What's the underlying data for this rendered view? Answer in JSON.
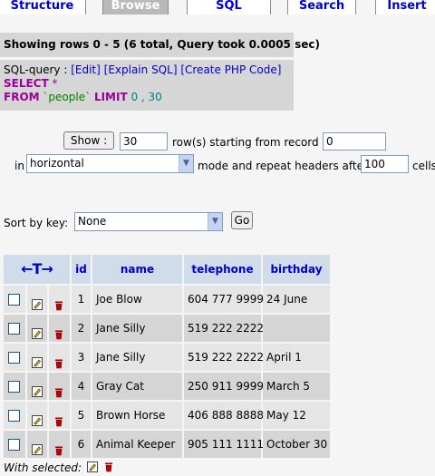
{
  "tabs": [
    {
      "label": "Structure",
      "active": false
    },
    {
      "label": "Browse",
      "active": true
    },
    {
      "label": "SQL",
      "active": false
    },
    {
      "label": "Search",
      "active": false
    },
    {
      "label": "Insert",
      "active": false
    }
  ],
  "status_message": "Showing rows 0 - 5 (6 total, Query took 0.0005 sec)",
  "sql": {
    "label": "SQL-query :",
    "edit": "[Edit]",
    "explain": "[Explain SQL]",
    "create_php": "[Create PHP Code]",
    "select_kw": "SELECT",
    "star": "*",
    "from_kw": "FROM",
    "table": "`people`",
    "limit_kw": "LIMIT",
    "limit_args": "0 , 30"
  },
  "nav": {
    "show_button": "Show :",
    "rows_value": "30",
    "rows_text": "row(s) starting from record #",
    "start_value": "0",
    "in_text": "in",
    "mode_value": "horizontal",
    "mode_text": "mode and repeat headers after",
    "repeat_value": "100",
    "cells_text": "cells"
  },
  "sort": {
    "label": "Sort by key:",
    "value": "None",
    "go_button": "Go"
  },
  "table": {
    "arrows": "←T→",
    "headers": [
      "id",
      "name",
      "telephone",
      "birthday"
    ],
    "rows": [
      {
        "id": "1",
        "name": "Joe Blow",
        "telephone": "604 777 9999",
        "birthday": "24 June"
      },
      {
        "id": "2",
        "name": "Jane Silly",
        "telephone": "519 222 2222",
        "birthday": ""
      },
      {
        "id": "3",
        "name": "Jane Silly",
        "telephone": "519 222 2222",
        "birthday": "April 1"
      },
      {
        "id": "4",
        "name": "Gray Cat",
        "telephone": "250 911 9999",
        "birthday": "March 5"
      },
      {
        "id": "5",
        "name": "Brown Horse",
        "telephone": "406 888 8888",
        "birthday": "May 12"
      },
      {
        "id": "6",
        "name": "Animal Keeper",
        "telephone": "905 111 1111",
        "birthday": "October 30"
      }
    ]
  },
  "with_selected": "With selected:",
  "colors": {
    "tab_text": "#0000cc",
    "header_bg": "#d0dcea",
    "row_odd": "#e5e5e5",
    "row_even": "#d5d5d5",
    "status_bg": "#d6d6d6"
  },
  "icons": {
    "edit": "pencil-edit-icon",
    "delete": "trash-delete-icon"
  }
}
